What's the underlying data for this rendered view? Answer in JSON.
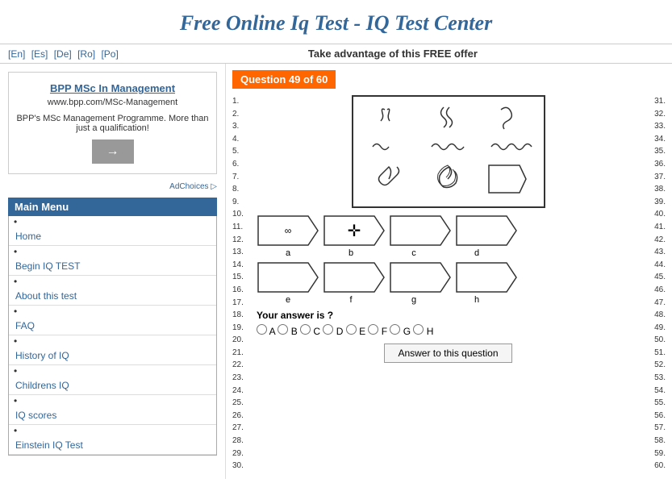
{
  "header": {
    "title": "Free Online Iq Test - IQ Test Center"
  },
  "langBar": {
    "links": [
      "[En]",
      "[Es]",
      "[De]",
      "[Ro]",
      "[Po]"
    ],
    "offer": "Take advantage of this FREE offer"
  },
  "ad": {
    "title": "BPP MSc In Management",
    "url": "www.bpp.com/MSc-Management",
    "description": "BPP's MSc Management Programme. More than just a qualification!",
    "arrow": "→"
  },
  "adChoices": "AdChoices ▷",
  "menu": {
    "title": "Main Menu",
    "items": [
      {
        "label": "Home",
        "href": "#"
      },
      {
        "label": "Begin IQ TEST",
        "href": "#"
      },
      {
        "label": "About this test",
        "href": "#"
      },
      {
        "label": "FAQ",
        "href": "#"
      },
      {
        "label": "History of IQ",
        "href": "#"
      },
      {
        "label": "Childrens IQ",
        "href": "#"
      },
      {
        "label": "IQ scores",
        "href": "#"
      },
      {
        "label": "Einstein IQ Test",
        "href": "#"
      }
    ]
  },
  "question": {
    "label": "Question 49 of 60",
    "answerPrompt": "Your answer is ?",
    "answerBtn": "Answer to this question",
    "choices": [
      "A",
      "B",
      "C",
      "D",
      "E",
      "F",
      "G",
      "H"
    ]
  },
  "leftNums": [
    "1.",
    "2.",
    "3.",
    "4.",
    "5.",
    "6.",
    "7.",
    "8.",
    "9.",
    "10.",
    "11.",
    "12.",
    "13.",
    "14.",
    "15.",
    "16.",
    "17.",
    "18.",
    "19.",
    "20.",
    "21.",
    "22.",
    "23.",
    "24.",
    "25.",
    "26.",
    "27.",
    "28.",
    "29.",
    "30."
  ],
  "rightNums": [
    "31.",
    "32.",
    "33.",
    "34.",
    "35.",
    "36.",
    "37.",
    "38.",
    "39.",
    "40.",
    "41.",
    "42.",
    "43.",
    "44.",
    "45.",
    "46.",
    "47.",
    "48.",
    "49.",
    "50.",
    "51.",
    "52.",
    "53.",
    "54.",
    "55.",
    "56.",
    "57.",
    "58.",
    "59.",
    "60."
  ]
}
